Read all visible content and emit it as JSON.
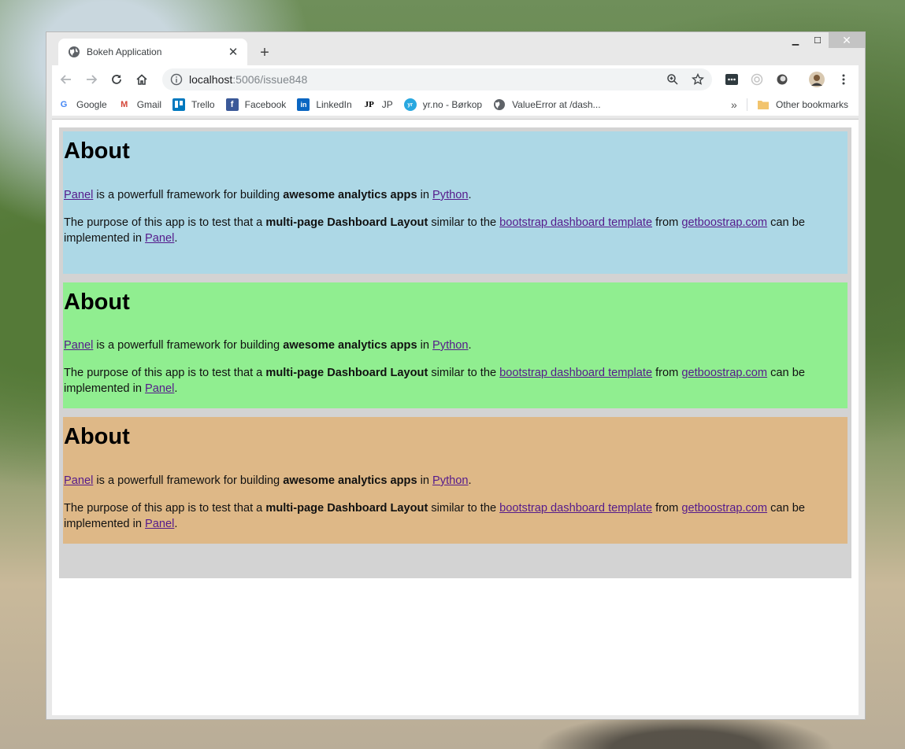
{
  "browser": {
    "tab_title": "Bokeh Application",
    "url_host": "localhost",
    "url_path": ":5006/issue848"
  },
  "bookmarks": [
    {
      "label": "Google",
      "icon": "google-icon"
    },
    {
      "label": "Gmail",
      "icon": "gmail-icon"
    },
    {
      "label": "Trello",
      "icon": "trello-icon"
    },
    {
      "label": "Facebook",
      "icon": "facebook-icon"
    },
    {
      "label": "LinkedIn",
      "icon": "linkedin-icon"
    },
    {
      "label": "JP",
      "icon": "jp-icon"
    },
    {
      "label": "yr.no - Børkop",
      "icon": "yr-icon"
    },
    {
      "label": "ValueError at /dash...",
      "icon": "globe-icon"
    }
  ],
  "bookmarks_overflow": "»",
  "other_bookmarks": "Other bookmarks",
  "colors": {
    "container": "#d3d3d3",
    "card1": "#add8e6",
    "card2": "#90ee90",
    "card3": "#deb887",
    "link": "#551a8b"
  },
  "cards": [
    {
      "heading": "About",
      "p1_link1": "Panel",
      "p1_text1": " is a powerfull framework for building ",
      "p1_bold": "awesome analytics apps",
      "p1_text2": " in ",
      "p1_link2": "Python",
      "p1_end": ".",
      "p2_text1": "The purpose of this app is to test that a ",
      "p2_bold": "multi-page Dashboard Layout",
      "p2_text2": " similar to the ",
      "p2_link1": "bootstrap dashboard template",
      "p2_text3": " from ",
      "p2_link2": "getboostrap.com",
      "p2_text4": " can be implemented in ",
      "p2_link3": "Panel",
      "p2_end": "."
    },
    {
      "heading": "About",
      "p1_link1": "Panel",
      "p1_text1": " is a powerfull framework for building ",
      "p1_bold": "awesome analytics apps",
      "p1_text2": " in ",
      "p1_link2": "Python",
      "p1_end": ".",
      "p2_text1": "The purpose of this app is to test that a ",
      "p2_bold": "multi-page Dashboard Layout",
      "p2_text2": " similar to the ",
      "p2_link1": "bootstrap dashboard template",
      "p2_text3": " from ",
      "p2_link2": "getboostrap.com",
      "p2_text4": " can be implemented in ",
      "p2_link3": "Panel",
      "p2_end": "."
    },
    {
      "heading": "About",
      "p1_link1": "Panel",
      "p1_text1": " is a powerfull framework for building ",
      "p1_bold": "awesome analytics apps",
      "p1_text2": " in ",
      "p1_link2": "Python",
      "p1_end": ".",
      "p2_text1": "The purpose of this app is to test that a ",
      "p2_bold": "multi-page Dashboard Layout",
      "p2_text2": " similar to the ",
      "p2_link1": "bootstrap dashboard template",
      "p2_text3": " from ",
      "p2_link2": "getboostrap.com",
      "p2_text4": " can be implemented in ",
      "p2_link3": "Panel",
      "p2_end": "."
    }
  ]
}
